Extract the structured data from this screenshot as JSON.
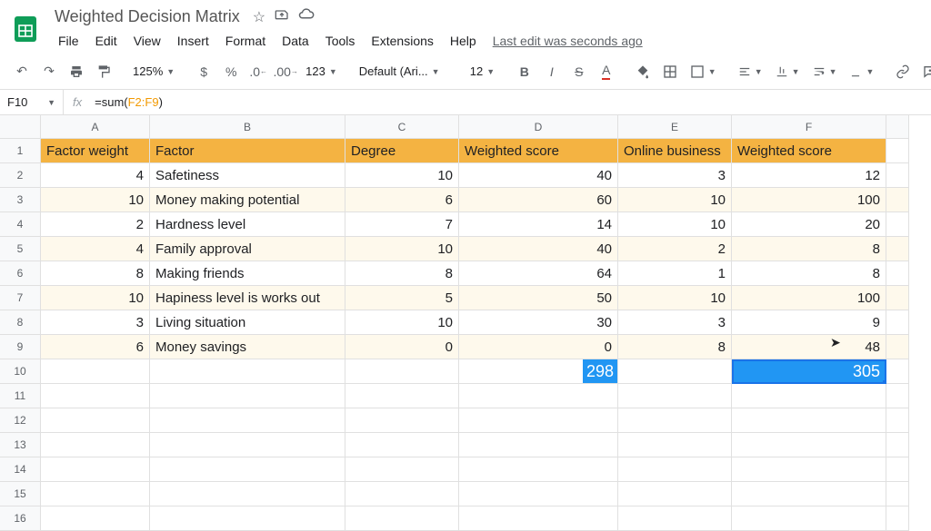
{
  "doc": {
    "title": "Weighted Decision Matrix",
    "last_edit": "Last edit was seconds ago"
  },
  "menu": [
    "File",
    "Edit",
    "View",
    "Insert",
    "Format",
    "Data",
    "Tools",
    "Extensions",
    "Help"
  ],
  "toolbar": {
    "zoom": "125%",
    "font": "Default (Ari...",
    "size": "12",
    "format_num": "123"
  },
  "formula": {
    "cell_ref": "F10",
    "formula_prefix": "=sum(",
    "formula_range": "F2:F9",
    "formula_suffix": ")"
  },
  "columns": [
    "A",
    "B",
    "C",
    "D",
    "E",
    "F"
  ],
  "headers": {
    "A": "Factor weight",
    "B": "Factor",
    "C": "Degree",
    "D": "Weighted score",
    "E": "Online business",
    "F": "Weighted score"
  },
  "rows": [
    {
      "w": "4",
      "factor": "Safetiness",
      "deg": "10",
      "ws1": "40",
      "ob": "3",
      "ws2": "12"
    },
    {
      "w": "10",
      "factor": "Money making potential",
      "deg": "6",
      "ws1": "60",
      "ob": "10",
      "ws2": "100"
    },
    {
      "w": "2",
      "factor": "Hardness level",
      "deg": "7",
      "ws1": "14",
      "ob": "10",
      "ws2": "20"
    },
    {
      "w": "4",
      "factor": "Family approval",
      "deg": "10",
      "ws1": "40",
      "ob": "2",
      "ws2": "8"
    },
    {
      "w": "8",
      "factor": "Making friends",
      "deg": "8",
      "ws1": "64",
      "ob": "1",
      "ws2": "8"
    },
    {
      "w": "10",
      "factor": "Hapiness level is works out",
      "deg": "5",
      "ws1": "50",
      "ob": "10",
      "ws2": "100"
    },
    {
      "w": "3",
      "factor": "Living situation",
      "deg": "10",
      "ws1": "30",
      "ob": "3",
      "ws2": "9"
    },
    {
      "w": "6",
      "factor": "Money savings",
      "deg": "0",
      "ws1": "0",
      "ob": "8",
      "ws2": "48"
    }
  ],
  "totals": {
    "d": "298",
    "f": "305"
  },
  "chart_data": {
    "type": "table",
    "title": "Weighted Decision Matrix",
    "columns": [
      "Factor weight",
      "Factor",
      "Degree",
      "Weighted score",
      "Online business",
      "Weighted score"
    ],
    "data": [
      [
        4,
        "Safetiness",
        10,
        40,
        3,
        12
      ],
      [
        10,
        "Money making potential",
        6,
        60,
        10,
        100
      ],
      [
        2,
        "Hardness level",
        7,
        14,
        10,
        20
      ],
      [
        4,
        "Family approval",
        10,
        40,
        2,
        8
      ],
      [
        8,
        "Making friends",
        8,
        64,
        1,
        8
      ],
      [
        10,
        "Hapiness level is works out",
        5,
        50,
        10,
        100
      ],
      [
        3,
        "Living situation",
        10,
        30,
        3,
        9
      ],
      [
        6,
        "Money savings",
        0,
        0,
        8,
        48
      ]
    ],
    "totals": {
      "Weighted score (D)": 298,
      "Weighted score (F)": 305
    }
  }
}
